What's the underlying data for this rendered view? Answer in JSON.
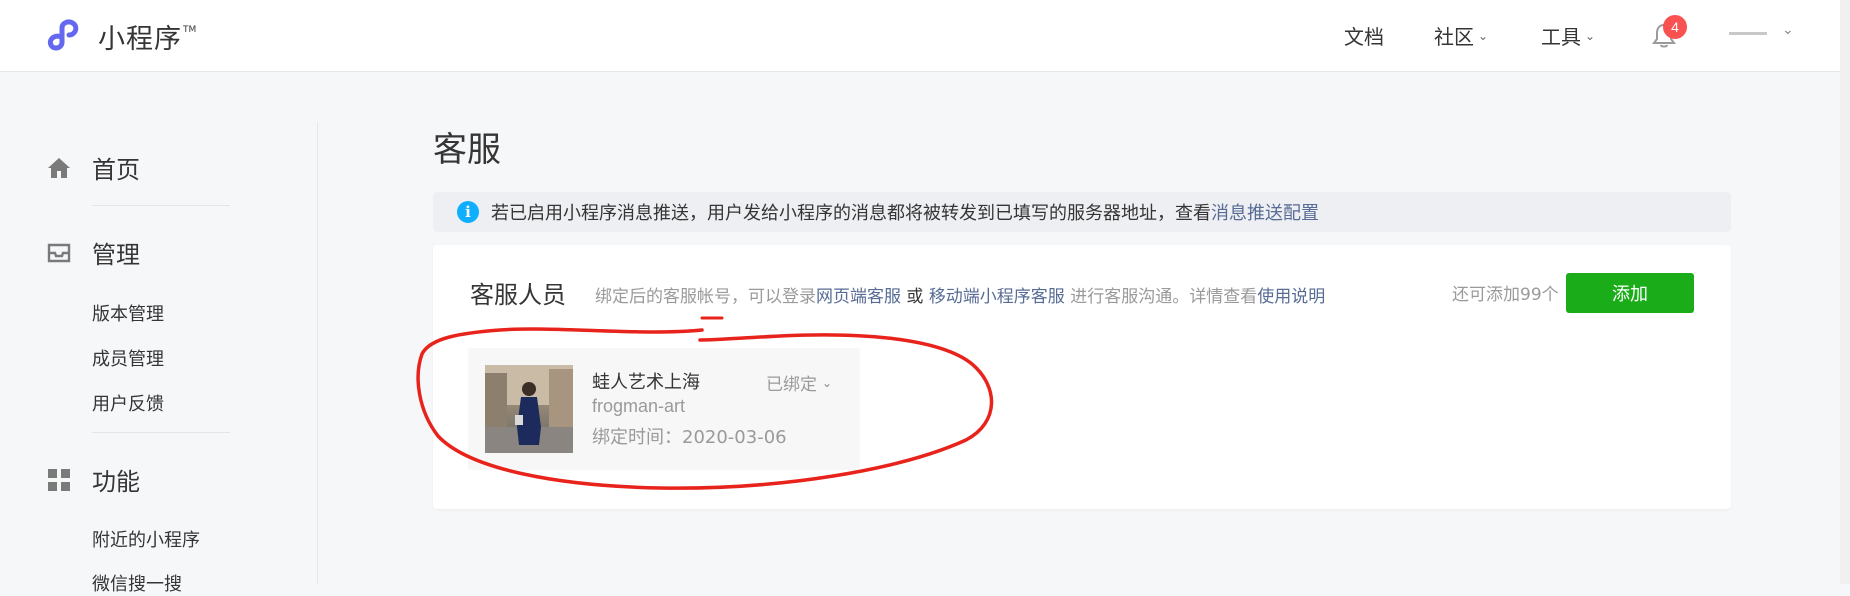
{
  "header": {
    "app_name": "小程序",
    "trademark": "TM",
    "nav": [
      {
        "label": "文档",
        "has_dropdown": false
      },
      {
        "label": "社区",
        "has_dropdown": true
      },
      {
        "label": "工具",
        "has_dropdown": true
      }
    ],
    "notification_count": "4",
    "brand_color": "#6467f0"
  },
  "sidebar": {
    "groups": [
      {
        "label": "首页",
        "icon": "home-icon",
        "items": []
      },
      {
        "label": "管理",
        "icon": "inbox-icon",
        "items": [
          "版本管理",
          "成员管理",
          "用户反馈"
        ]
      },
      {
        "label": "功能",
        "icon": "grid-icon",
        "items": [
          "附近的小程序",
          "微信搜一搜"
        ]
      }
    ]
  },
  "main": {
    "title": "客服",
    "notice": {
      "text": "若已启用小程序消息推送，用户发给小程序的消息都将被转发到已填写的服务器地址，查看 ",
      "link": "消息推送配置"
    },
    "card": {
      "title": "客服人员",
      "desc_part1": "绑定后的客服帐号，可以登录",
      "link_web": "网页端客服",
      "desc_or": " 或 ",
      "link_mobile": "移动端小程序客服",
      "desc_part2": " 进行客服沟通。详情查看",
      "link_help": "使用说明",
      "remaining": "还可添加99个",
      "add_label": "添加",
      "member": {
        "name": "蛙人艺术上海",
        "account": "frogman-art",
        "bind_time": "绑定时间：2020-03-06",
        "status": "已绑定"
      }
    }
  },
  "colors": {
    "link": "#576b95",
    "primary_button": "#1aad19",
    "annotation": "#e8231c",
    "badge": "#fa5151",
    "info": "#10aeff"
  }
}
